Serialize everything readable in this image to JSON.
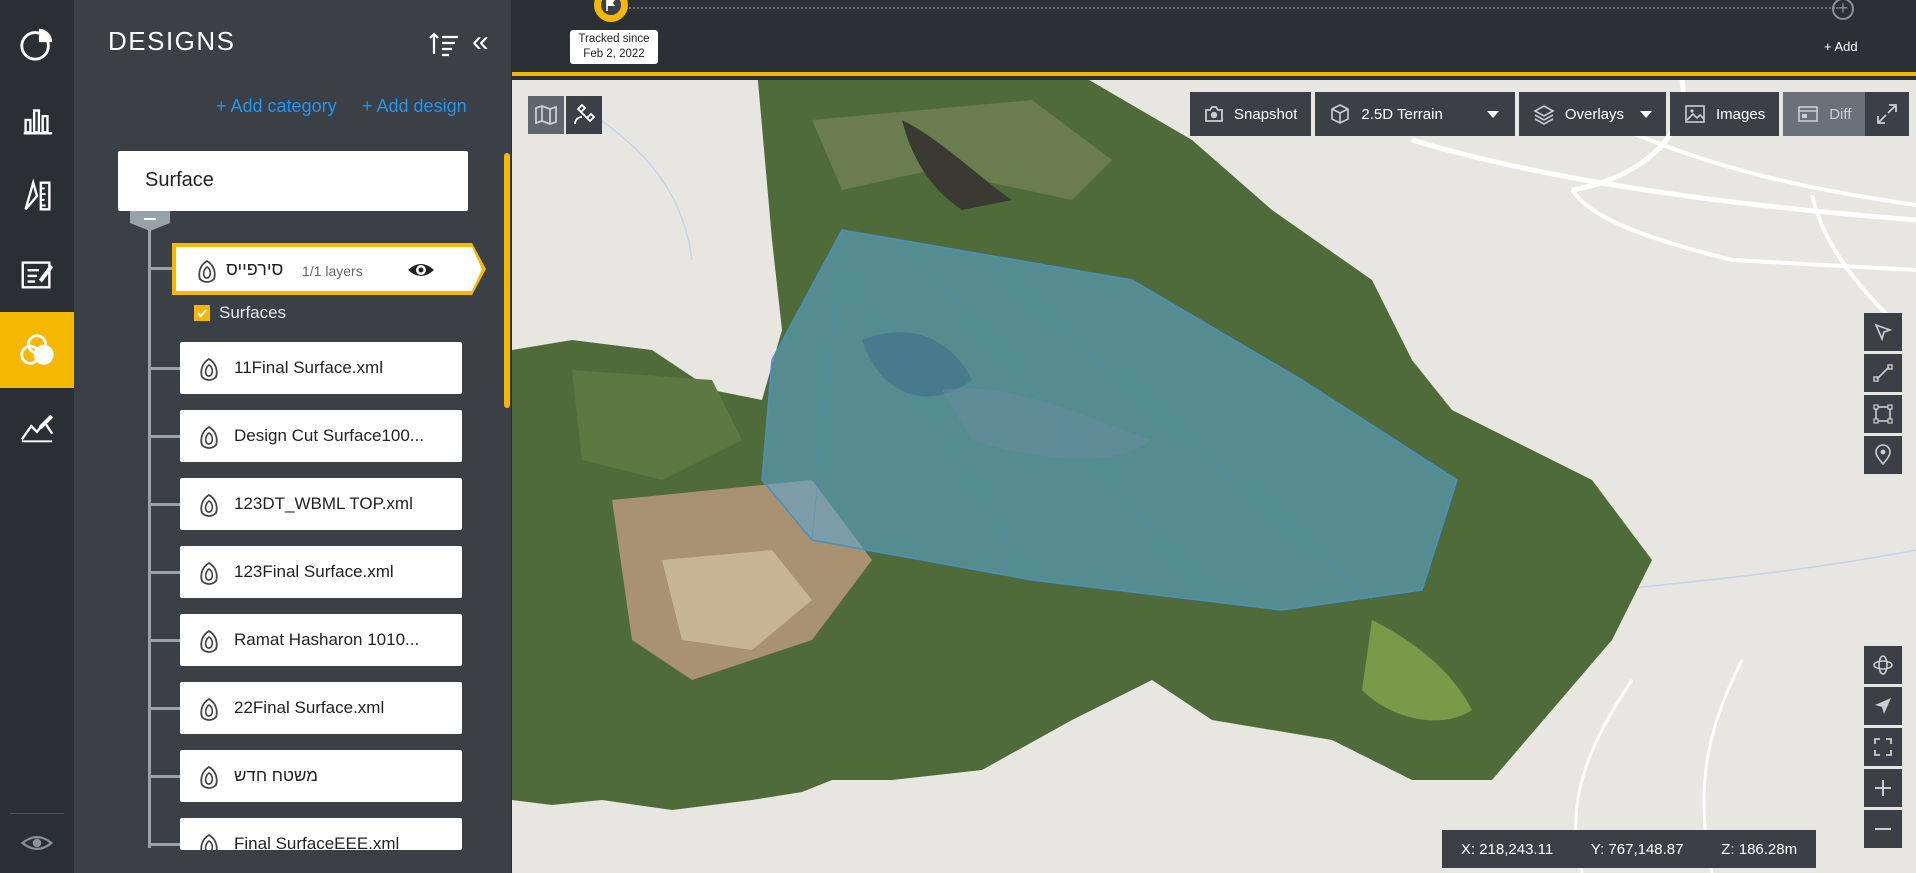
{
  "sidebar_rail": {
    "items": [
      {
        "icon": "pie-chart-icon"
      },
      {
        "icon": "bar-chart-icon"
      },
      {
        "icon": "ruler-measure-icon"
      },
      {
        "icon": "report-edit-icon"
      },
      {
        "icon": "designs-layers-icon",
        "active": true
      },
      {
        "icon": "annotate-pen-icon"
      }
    ],
    "bottom_icon": "eye-icon"
  },
  "designs_panel": {
    "title": "DESIGNS",
    "add_category": "+ Add category",
    "add_design": "+ Add design",
    "category": "Surface",
    "active_design": {
      "name": "סירפייס",
      "layers": "1/1 layers"
    },
    "layer_checkbox": "Surfaces",
    "designs": [
      "11Final Surface.xml",
      "Design Cut Surface100...",
      "123DT_WBML TOP.xml",
      "123Final Surface.xml",
      "Ramat Hasharon 1010...",
      "22Final Surface.xml",
      "משטח חדש",
      "Final SurfaceEEE.xml"
    ]
  },
  "timeline": {
    "tracked_line1": "Tracked since",
    "tracked_line2": "Feb 2, 2022",
    "add_label": "+ Add"
  },
  "map_toolbar": {
    "snapshot": "Snapshot",
    "terrain": "2.5D Terrain",
    "overlays": "Overlays",
    "images": "Images",
    "diff": "Diff"
  },
  "coordinates": {
    "x": "X: 218,243.11",
    "y": "Y: 767,148.87",
    "z": "Z: 186.28m"
  },
  "colors": {
    "accent": "#f5b800",
    "link": "#2196f3",
    "panel": "#3a4046",
    "rail": "#2a2f34",
    "overlay": "#5aa8d6"
  }
}
